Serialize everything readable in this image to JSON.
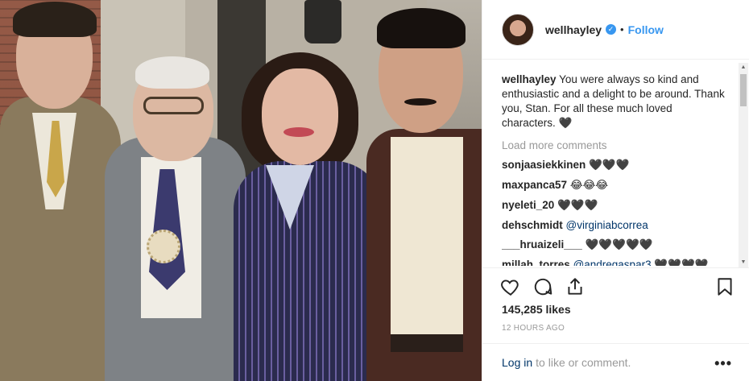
{
  "post": {
    "username": "wellhayley",
    "follow_label": "Follow",
    "dot": "•",
    "verified_glyph": "✓",
    "caption_user": "wellhayley",
    "caption_text": "You were always so kind and enthusiastic and a delight to be around. Thank you, Stan. For all these much loved characters. 🖤",
    "load_more": "Load more comments",
    "comments": [
      {
        "user": "sonjaasiekkinen",
        "text": "🖤🖤🖤",
        "mention": ""
      },
      {
        "user": "maxpanca57",
        "text": "😂😂😂",
        "mention": ""
      },
      {
        "user": "nyeleti_20",
        "text": "🖤🖤🖤",
        "mention": ""
      },
      {
        "user": "dehschmidt",
        "text": "",
        "mention": "@virginiabcorrea"
      },
      {
        "user": "___hruaizeli___",
        "text": "🖤🖤🖤🖤🖤",
        "mention": ""
      },
      {
        "user": "millah_torres",
        "text": "🖤🖤🖤🖤",
        "mention": "@andregaspar3"
      }
    ],
    "likes": "145,285 likes",
    "time": "12 HOURS AGO",
    "login_link": "Log in",
    "login_rest": "to like or comment.",
    "more_label": "•••"
  },
  "colors": {
    "accent": "#3897f0",
    "link": "#003569",
    "muted": "#999999"
  }
}
